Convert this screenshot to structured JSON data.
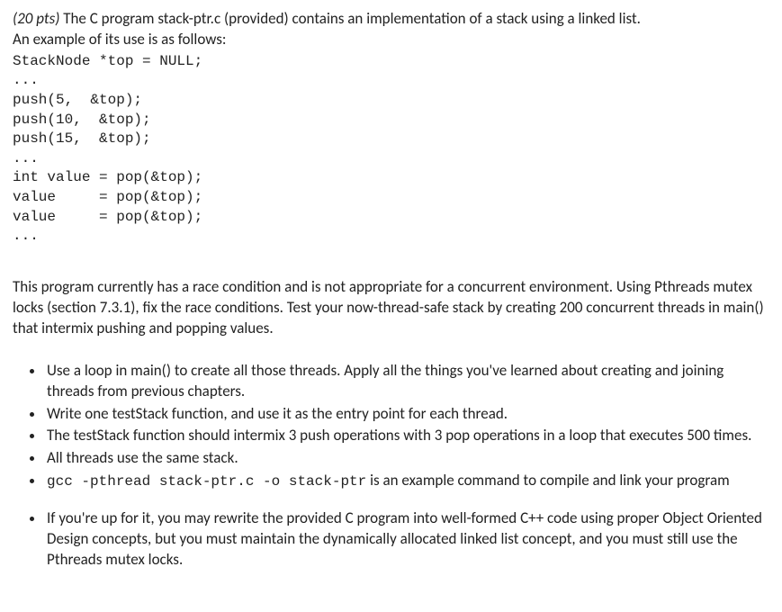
{
  "intro": {
    "points": "(20 pts)",
    "line1_rest": " The C program stack-ptr.c (provided) contains an implementation of a stack using a linked list.",
    "line2": "An example of its use is as follows:"
  },
  "code": {
    "decl": "StackNode *top = NULL;",
    "ellipsis1": "...",
    "push1": "push(5,  &top);",
    "push2": "push(10,  &top);",
    "push3": "push(15,  &top);",
    "ellipsis2": "...",
    "pop1": "int value = pop(&top);",
    "pop2": "value     = pop(&top);",
    "pop3": "value     = pop(&top);",
    "ellipsis3": "..."
  },
  "body": {
    "para1": "This program currently has a race condition and is not appropriate for a concurrent environment. Using Pthreads mutex locks (section 7.3.1), fix the race conditions.  Test your now-thread-safe stack by creating 200 concurrent threads in main() that intermix pushing and popping values."
  },
  "bullets": {
    "b1": "Use a loop in main() to create all those threads.  Apply all the things you've learned about creating and joining threads from previous chapters.",
    "b2": "Write one testStack function, and use it as the entry point for each thread.",
    "b3": "The testStack function should intermix 3 push operations with 3 pop operations in a loop that executes 500 times.",
    "b4": "All threads use the same stack.",
    "b5_code": "gcc -pthread stack-ptr.c -o stack-ptr",
    "b5_rest": "  is an example command to compile and link your program",
    "b6": "If you're up for it, you may rewrite the provided C program into well-formed C++ code using proper Object Oriented Design concepts, but you must maintain the dynamically allocated linked list concept, and you must still use the Pthreads mutex locks."
  }
}
